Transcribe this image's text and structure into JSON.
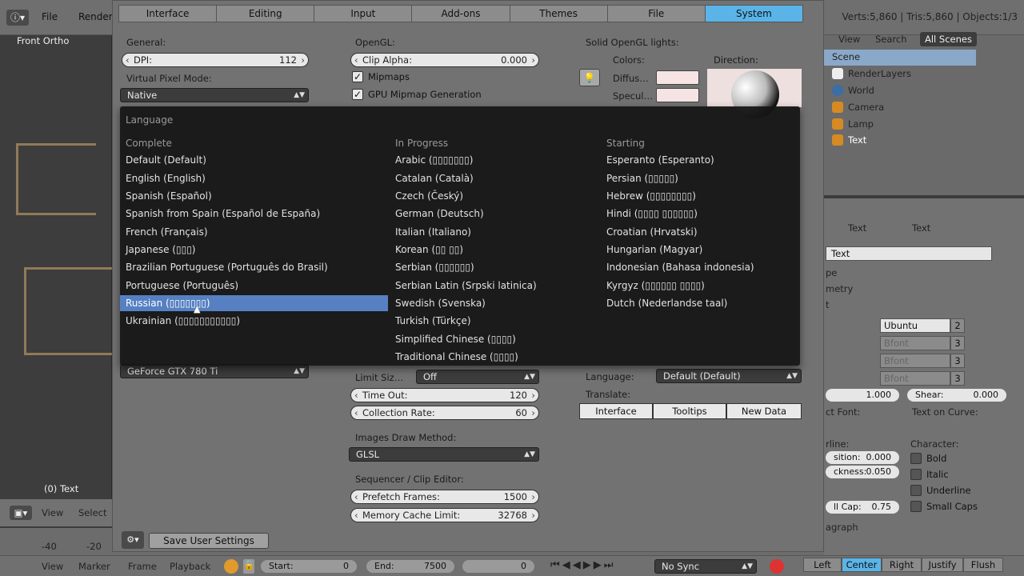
{
  "topbar": {
    "menus": [
      "File",
      "Render"
    ],
    "stats": "Verts:5,860 | Tris:5,860 | Objects:1/3"
  },
  "viewport": {
    "view_name": "Front Ortho",
    "object_label": "(0) Text",
    "header_menus": [
      "View",
      "Select"
    ]
  },
  "outliner": {
    "view_menu": "View",
    "search_menu": "Search",
    "filter": "All Scenes",
    "items": [
      "Scene",
      "RenderLayers",
      "World",
      "Camera",
      "Lamp",
      "Text"
    ]
  },
  "properties": {
    "breadcrumb": [
      "Text",
      "Text"
    ],
    "datablock": "Text",
    "fonts": [
      "Ubuntu",
      "Bfont",
      "Bfont",
      "Bfont"
    ],
    "font_users": [
      "2",
      "3",
      "3",
      "3"
    ],
    "size_value": "1.000",
    "shear": "Shear:",
    "shear_value": "0.000",
    "object_font": "ct Font:",
    "text_on_curve": "Text on Curve:",
    "underline_label": "rline:",
    "position_label": "sition:",
    "position_value": "0.000",
    "thickness_label": "ckness:",
    "thickness_value": "0.050",
    "smallcaps_label": "ll Cap:",
    "smallcaps_value": "0.75",
    "character": "Character:",
    "bold": "Bold",
    "italic": "Italic",
    "underline": "Underline",
    "small_caps": "Small Caps",
    "paragraph": "agraph",
    "align_buttons": [
      "Left",
      "Center",
      "Right",
      "Justify",
      "Flush"
    ],
    "panels": [
      "pe",
      "metry",
      "t"
    ]
  },
  "timeline": {
    "menus": [
      "View",
      "Marker",
      "Frame",
      "Playback"
    ],
    "start_label": "Start:",
    "start_value": "0",
    "end_label": "End:",
    "end_value": "7500",
    "current_frame": "0",
    "sync": "No Sync",
    "ticks": [
      "-40",
      "-20"
    ]
  },
  "prefs": {
    "tabs": [
      "Interface",
      "Editing",
      "Input",
      "Add-ons",
      "Themes",
      "File",
      "System"
    ],
    "active_tab": "System",
    "general_label": "General:",
    "dpi_label": "DPI:",
    "dpi_value": "112",
    "virtual_pixel_label": "Virtual Pixel Mode:",
    "virtual_pixel_value": "Native",
    "opengl_label": "OpenGL:",
    "clip_alpha_label": "Clip Alpha:",
    "clip_alpha_value": "0.000",
    "mipmaps": "Mipmaps",
    "gpu_mipmap": "GPU Mipmap Generation",
    "solid_lights_label": "Solid OpenGL lights:",
    "colors_label": "Colors:",
    "direction_label": "Direction:",
    "diffuse_label": "Diffus…",
    "specular_label": "Specul…",
    "gpu_name": "GeForce GTX 780 Ti",
    "limit_size_label": "Limit Siz…",
    "limit_size_value": "Off",
    "time_out_label": "Time Out:",
    "time_out_value": "120",
    "collection_rate_label": "Collection Rate:",
    "collection_rate_value": "60",
    "images_draw_label": "Images Draw Method:",
    "images_draw_value": "GLSL",
    "sequencer_label": "Sequencer / Clip Editor:",
    "prefetch_label": "Prefetch Frames:",
    "prefetch_value": "1500",
    "memory_cache_label": "Memory Cache Limit:",
    "memory_cache_value": "32768",
    "language_label": "Language:",
    "language_value": "Default (Default)",
    "translate_label": "Translate:",
    "translate_buttons": [
      "Interface",
      "Tooltips",
      "New Data"
    ],
    "save_button": "Save User Settings"
  },
  "language_menu": {
    "title": "Language",
    "columns": [
      {
        "heading": "Complete",
        "items": [
          "Default (Default)",
          "English (English)",
          "Spanish (Español)",
          "Spanish from Spain (Español de España)",
          "French (Français)",
          "Japanese (▯▯▯)",
          "Brazilian Portuguese (Português do Brasil)",
          "Portuguese (Português)",
          "Russian (▯▯▯▯▯▯▯)",
          "Ukrainian (▯▯▯▯▯▯▯▯▯▯▯)"
        ]
      },
      {
        "heading": "In Progress",
        "items": [
          "Arabic (▯▯▯▯▯▯▯)",
          "Catalan (Català)",
          "Czech (Český)",
          "German (Deutsch)",
          "Italian (Italiano)",
          "Korean (▯▯ ▯▯)",
          "Serbian (▯▯▯▯▯▯)",
          "Serbian Latin (Srpski latinica)",
          "Swedish (Svenska)",
          "Turkish (Türkçe)",
          "Simplified Chinese (▯▯▯▯)",
          "Traditional Chinese (▯▯▯▯)"
        ]
      },
      {
        "heading": "Starting",
        "items": [
          "Esperanto (Esperanto)",
          "Persian (▯▯▯▯▯)",
          "Hebrew (▯▯▯▯▯▯▯▯)",
          "Hindi (▯▯▯▯ ▯▯▯▯▯▯)",
          "Croatian (Hrvatski)",
          "Hungarian (Magyar)",
          "Indonesian (Bahasa indonesia)",
          "Kyrgyz (▯▯▯▯▯▯ ▯▯▯▯)",
          "Dutch (Nederlandse taal)"
        ]
      }
    ],
    "selected": "Russian (▯▯▯▯▯▯▯)",
    "colors": {
      "selected_bg": "#5680c2",
      "active_tab": "#5ab4e8"
    }
  }
}
